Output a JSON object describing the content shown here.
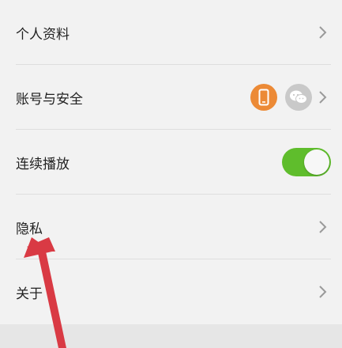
{
  "settings": {
    "items": [
      {
        "label": "个人资料"
      },
      {
        "label": "账号与安全"
      },
      {
        "label": "连续播放"
      },
      {
        "label": "隐私"
      },
      {
        "label": "关于"
      }
    ]
  },
  "continuous_play_enabled": true,
  "colors": {
    "background": "#f2f2f2",
    "divider": "#dedede",
    "toggle_on": "#5fbd2c",
    "phone_badge": "#ec8a36",
    "wechat_badge": "#c9c9c9",
    "annotation_arrow": "#d93a44"
  },
  "icons": [
    "chevron-right-icon",
    "phone-icon",
    "wechat-icon"
  ]
}
